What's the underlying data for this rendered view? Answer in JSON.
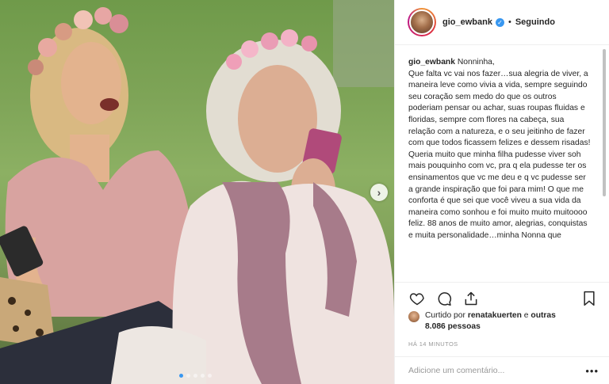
{
  "post": {
    "username": "gio_ewbank",
    "separator": "•",
    "follow_status": "Seguindo",
    "verified_glyph": "✓"
  },
  "caption": {
    "username": "gio_ewbank",
    "text": "Nonninha,\nQue falta vc vai nos fazer…sua alegria de viver, a maneira leve como vivia a vida, sempre seguindo seu coração sem medo do que os outros poderiam pensar ou achar, suas roupas fluidas e floridas, sempre com flores na cabeça, sua relação com a natureza, e o seu jeitinho de fazer com que todos ficassem felizes e dessem risadas! Queria muito que minha filha pudesse viver soh mais pouquinho com vc, pra q ela pudesse ter os ensinamentos que vc me deu e q vc pudesse ser a grande inspiração que foi para mim! O que me conforta é que sei que você viveu a sua vida da maneira como sonhou e foi muito muito muitoooo feliz. 88 anos de muito amor, alegrias, conquistas e muita personalidade…minha Nonna que"
  },
  "likes": {
    "prefix": "Curtido por",
    "first_liker": "renatakuerten",
    "connector": "e",
    "others": "outras 8.086 pessoas"
  },
  "timestamp": "HÁ 14 MINUTOS",
  "comment": {
    "placeholder": "Adicione um comentário...",
    "more": "•••"
  },
  "carousel": {
    "next_glyph": "›",
    "dot_count": 5,
    "active_index": 0
  },
  "icons": {
    "like": "heart-icon",
    "comment": "comment-icon",
    "share": "share-icon",
    "save": "bookmark-icon"
  },
  "colors": {
    "accent": "#3897f0",
    "text": "#262626",
    "muted": "#999999",
    "border": "#efefef"
  }
}
